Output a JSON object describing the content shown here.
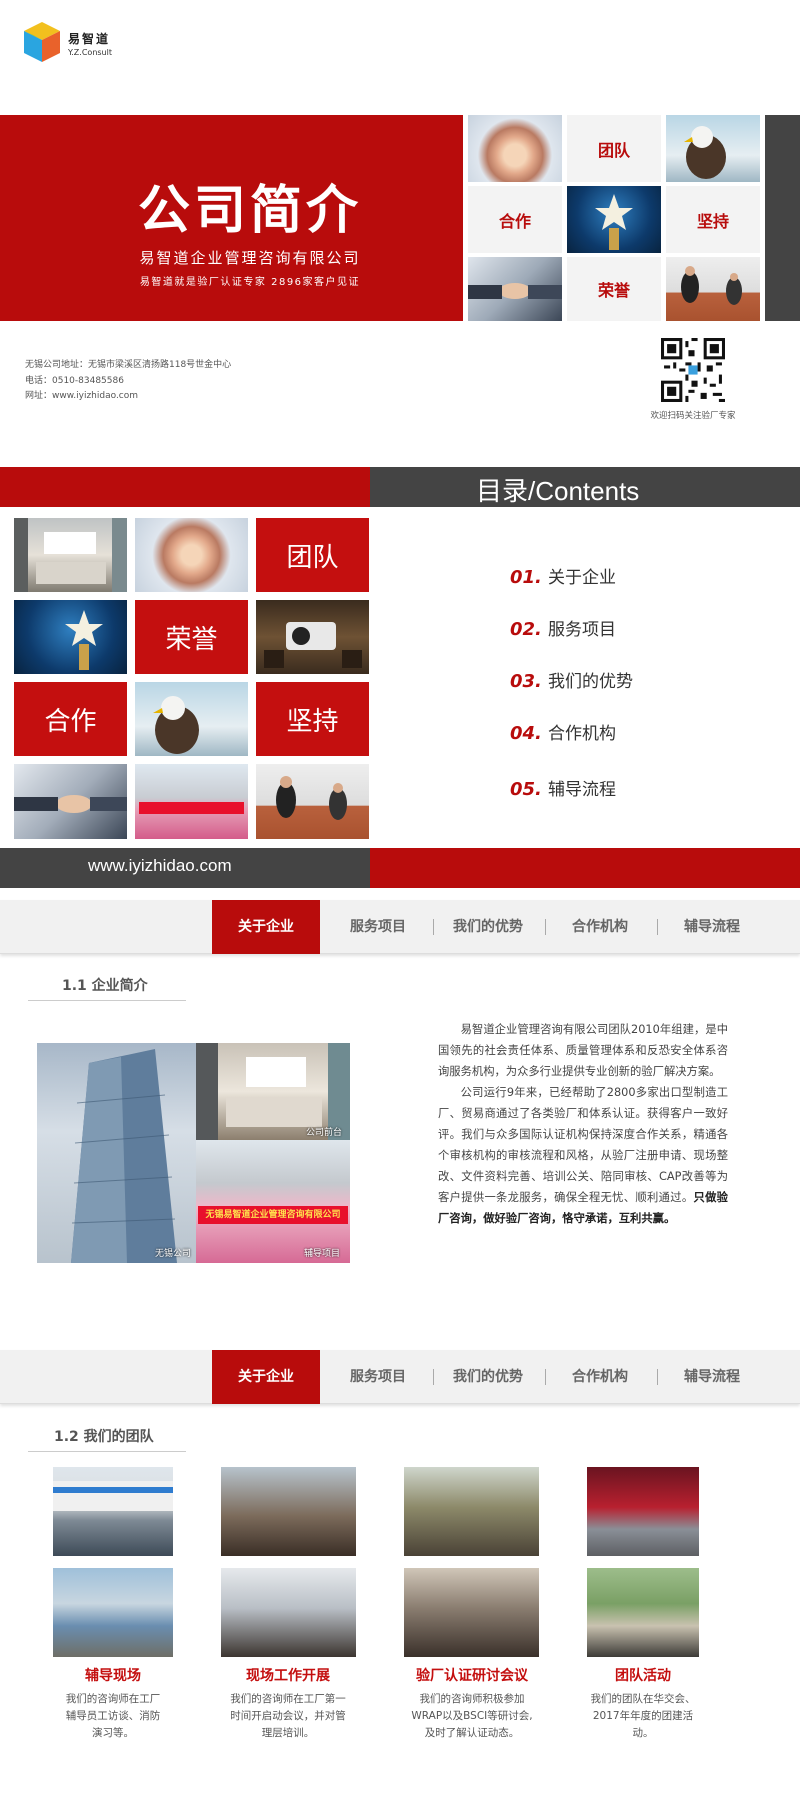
{
  "logo": {
    "cn": "易智道",
    "en": "Y.Z.Consult"
  },
  "cover": {
    "title": "公司简介",
    "company": "易智道企业管理咨询有限公司",
    "slogan": "易智道就是验厂认证专家 2896家客户见证",
    "tiles": {
      "team": "团队",
      "cooperation": "合作",
      "persist": "坚持",
      "honor": "荣誉"
    }
  },
  "contact": {
    "address": "无锡公司地址：无锡市梁溪区清扬路118号世金中心",
    "phone": "电话：0510-83485586",
    "website": "网址：www.iyizhidao.com",
    "qr_caption": "欢迎扫码关注验厂专家"
  },
  "toc": {
    "title": "目录/Contents",
    "tiles": {
      "team": "团队",
      "honor": "荣誉",
      "cooperation": "合作",
      "persist": "坚持"
    },
    "items": [
      {
        "num": "01.",
        "label": "关于企业"
      },
      {
        "num": "02.",
        "label": "服务项目"
      },
      {
        "num": "03.",
        "label": "我们的优势"
      },
      {
        "num": "04.",
        "label": "合作机构"
      },
      {
        "num": "05.",
        "label": "辅导流程"
      }
    ],
    "url": "www.iyizhidao.com"
  },
  "nav": {
    "items": [
      "关于企业",
      "服务项目",
      "我们的优势",
      "合作机构",
      "辅导流程"
    ]
  },
  "intro": {
    "heading": "1.1 企业简介",
    "p1": "易智道企业管理咨询有限公司团队2010年组建，是中国领先的社会责任体系、质量管理体系和反恐安全体系咨询服务机构，为众多行业提供专业创新的验厂解决方案。",
    "p2": "公司运行9年来，已经帮助了2800多家出口型制造工厂、贸易商通过了各类验厂和体系认证。获得客户一致好评。我们与众多国际认证机构保持深度合作关系，精通各个审核机构的审核流程和风格，从验厂注册申请、现场整改、文件资料完善、培训公关、陪同审核、CAP改善等为客户提供一条龙服务，确保全程无忧、顺利通过。",
    "p2_bold": "只做验厂咨询，做好验厂咨询，恪守承诺，互利共赢。",
    "photo_labels": {
      "reception": "公司前台",
      "building": "无锡公司",
      "project": "辅导项目"
    },
    "banner_text": "无锡易智道企业管理咨询有限公司"
  },
  "team": {
    "heading": "1.2 我们的团队",
    "columns": [
      {
        "caption": "辅导现场",
        "desc": [
          "我们的咨询师在工厂",
          "辅导员工访谈、消防",
          "演习等。"
        ]
      },
      {
        "caption": "现场工作开展",
        "desc": [
          "我们的咨询师在工厂第一",
          "时间开启动会议，并对管",
          "理层培训。"
        ]
      },
      {
        "caption": "验厂认证研讨会议",
        "desc": [
          "我们的咨询师积极参加",
          "WRAP以及BSCI等研讨会,",
          "及时了解认证动态。"
        ]
      },
      {
        "caption": "团队活动",
        "desc": [
          "我们的团队在华交会、",
          "2017年年度的团建活",
          "动。"
        ]
      }
    ]
  }
}
